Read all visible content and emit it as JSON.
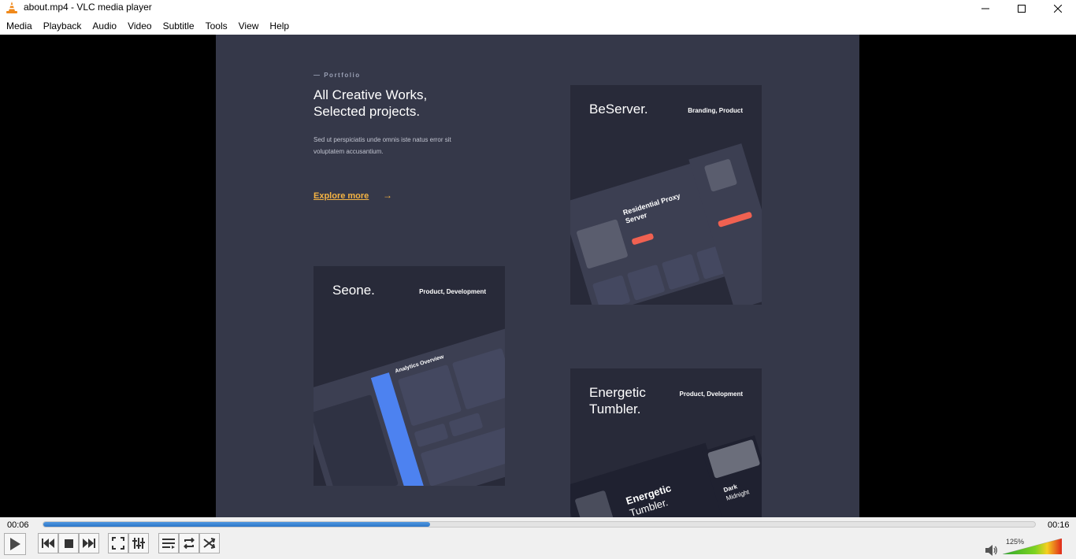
{
  "window": {
    "title": "about.mp4 - VLC media player"
  },
  "menu": [
    "Media",
    "Playback",
    "Audio",
    "Video",
    "Subtitle",
    "Tools",
    "View",
    "Help"
  ],
  "video_frame": {
    "eyebrow": "— Portfolio",
    "headline_line1": "All Creative Works,",
    "headline_line2": "Selected projects.",
    "lead_line1": "Sed ut perspiciatis unde omnis iste natus error sit",
    "lead_line2": "voluptatem accusantium.",
    "explore_label": "Explore more",
    "cards": {
      "beserver": {
        "name": "BeServer.",
        "tag": "Branding, Product",
        "mock_title": "Residential Proxy Server"
      },
      "seone": {
        "name": "Seone.",
        "tag": "Product, Development",
        "mock_title": "Analytics Overview"
      },
      "tumbler": {
        "name_line1": "Energetic",
        "name_line2": "Tumbler.",
        "tag": "Product, Dvelopment",
        "mock_title_1": "Energetic",
        "mock_title_2": "Tumbler.",
        "mock_side_1": "Dark",
        "mock_side_2": "Midnight"
      }
    }
  },
  "playback": {
    "elapsed": "00:06",
    "total": "00:16",
    "progress_fraction": 0.39,
    "volume_label": "125%",
    "volume_fraction": 1.0
  },
  "colors": {
    "accent": "#f5b443",
    "seek_fill": "#2d76c7",
    "frame_bg": "#353849",
    "card_bg": "#282a39"
  },
  "icons": {
    "app": "vlc-cone-icon",
    "play": "play-icon",
    "prev": "previous-icon",
    "stop": "stop-icon",
    "next": "next-icon",
    "fullscreen": "fullscreen-icon",
    "extended": "extended-settings-icon",
    "playlist": "playlist-icon",
    "loop": "loop-icon",
    "random": "shuffle-icon",
    "volume": "speaker-icon"
  }
}
